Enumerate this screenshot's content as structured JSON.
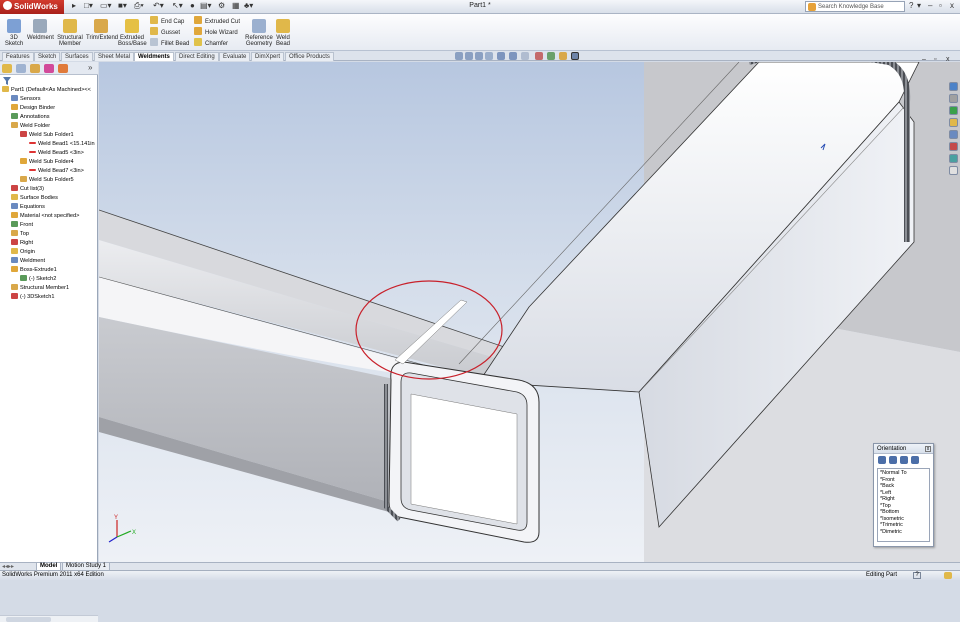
{
  "app": {
    "logo_text": "SolidWorks",
    "doc_title": "Part1 *",
    "search_placeholder": "Search Knowledge Base",
    "help": "?",
    "min": "–",
    "restore": "▫",
    "close": "x"
  },
  "ribbon": {
    "large": [
      {
        "label": "3D\nSketch"
      },
      {
        "label": "Weldment"
      },
      {
        "label": "Structural\nMember"
      },
      {
        "label": "Trim/Extend"
      },
      {
        "label": "Extruded\nBoss/Base"
      }
    ],
    "small": [
      {
        "label": "End Cap"
      },
      {
        "label": "Gusset"
      },
      {
        "label": "Fillet Bead"
      },
      {
        "label": "Extruded Cut"
      },
      {
        "label": "Hole Wizard"
      },
      {
        "label": "Chamfer"
      }
    ],
    "large2": [
      {
        "label": "Reference\nGeometry"
      },
      {
        "label": "Weld\nBead"
      }
    ]
  },
  "tabs": [
    "Features",
    "Sketch",
    "Surfaces",
    "Sheet Metal",
    "Weldments",
    "Direct Editing",
    "Evaluate",
    "DimXpert",
    "Office Products"
  ],
  "active_tab": "Weldments",
  "tree": [
    {
      "label": "Part1  (Default<As Machined><<",
      "indent": 0
    },
    {
      "label": "Sensors",
      "indent": 1
    },
    {
      "label": "Design Binder",
      "indent": 1
    },
    {
      "label": "Annotations",
      "indent": 1
    },
    {
      "label": "Weld Folder",
      "indent": 1
    },
    {
      "label": "Weld Sub Folder1",
      "indent": 2
    },
    {
      "label": "Weld Bead1 <15.141in",
      "indent": 3
    },
    {
      "label": "Weld Bead5 <3in>",
      "indent": 3
    },
    {
      "label": "Weld Sub Folder4",
      "indent": 2
    },
    {
      "label": "Weld Bead7 <3in>",
      "indent": 3
    },
    {
      "label": "Weld Sub Folder5",
      "indent": 2
    },
    {
      "label": "Cut list(3)",
      "indent": 1
    },
    {
      "label": "Surface Bodies",
      "indent": 1
    },
    {
      "label": "Equations",
      "indent": 1
    },
    {
      "label": "Material <not specified>",
      "indent": 1
    },
    {
      "label": "Front",
      "indent": 1
    },
    {
      "label": "Top",
      "indent": 1
    },
    {
      "label": "Right",
      "indent": 1
    },
    {
      "label": "Origin",
      "indent": 1
    },
    {
      "label": "Weldment",
      "indent": 1
    },
    {
      "label": "Boss-Extrude1",
      "indent": 1
    },
    {
      "label": "(-) Sketch2",
      "indent": 2
    },
    {
      "label": "Structural Member1",
      "indent": 1
    },
    {
      "label": "(-) 3DSketch1",
      "indent": 1
    }
  ],
  "bottom_tabs": [
    "Model",
    "Motion Study 1"
  ],
  "status": {
    "left": "SolidWorks Premium 2011 x64 Edition",
    "right": "Editing Part",
    "help": "?"
  },
  "orientation": {
    "title": "Orientation",
    "close": "x",
    "views": [
      "*Normal To",
      "*Front",
      "*Back",
      "*Left",
      "*Right",
      "*Top",
      "*Bottom",
      "*Isometric",
      "*Trimetric",
      "*Dimetric"
    ]
  },
  "axes": {
    "x": "X",
    "y": "Y"
  },
  "colors": {
    "accent": "#c0392b",
    "highlight_circle": "#c8202a"
  }
}
